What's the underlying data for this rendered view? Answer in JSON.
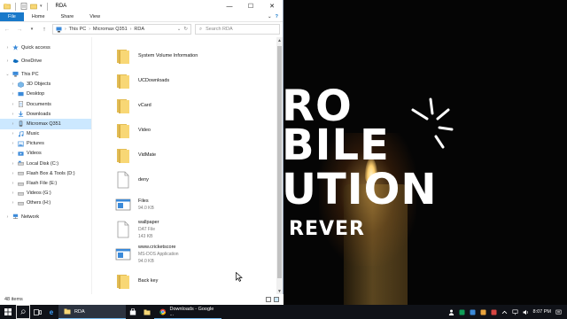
{
  "window": {
    "title": "RDA",
    "minimize": "—",
    "maximize": "☐",
    "close": "✕"
  },
  "ribbon": {
    "tabs": [
      "File",
      "Home",
      "Share",
      "View"
    ],
    "expand": "⌄",
    "help": "?"
  },
  "address": {
    "crumbs": [
      "This PC",
      "Micromax Q351",
      "RDA"
    ],
    "search_placeholder": "Search RDA"
  },
  "nav": {
    "items": [
      {
        "label": "Quick access",
        "icon": "star-icon"
      },
      {
        "label": "OneDrive",
        "icon": "cloud-icon"
      },
      {
        "label": "This PC",
        "icon": "pc-icon"
      },
      {
        "label": "3D Objects",
        "icon": "cube-icon"
      },
      {
        "label": "Desktop",
        "icon": "desktop-icon"
      },
      {
        "label": "Documents",
        "icon": "documents-icon"
      },
      {
        "label": "Downloads",
        "icon": "downloads-icon"
      },
      {
        "label": "Micromax Q351",
        "icon": "phone-icon"
      },
      {
        "label": "Music",
        "icon": "music-icon"
      },
      {
        "label": "Pictures",
        "icon": "pictures-icon"
      },
      {
        "label": "Videos",
        "icon": "videos-icon"
      },
      {
        "label": "Local Disk (C:)",
        "icon": "drive-icon"
      },
      {
        "label": "Flash Box & Tools (D:)",
        "icon": "drive-icon"
      },
      {
        "label": "Flash File (E:)",
        "icon": "drive-icon"
      },
      {
        "label": "Videos (G:)",
        "icon": "drive-icon"
      },
      {
        "label": "Others (H:)",
        "icon": "drive-icon"
      },
      {
        "label": "Network",
        "icon": "network-icon"
      }
    ]
  },
  "files": [
    {
      "name": "System Volume Information",
      "type": "folder"
    },
    {
      "name": "UCDownloads",
      "type": "folder"
    },
    {
      "name": "vCard",
      "type": "folder"
    },
    {
      "name": "Video",
      "type": "folder"
    },
    {
      "name": "VidMate",
      "type": "folder"
    },
    {
      "name": "deny",
      "type": "file"
    },
    {
      "name": "Files",
      "type": "app",
      "sub1": "94.0 KB"
    },
    {
      "name": "wallpaper",
      "type": "file",
      "sub1": "DAT File",
      "sub2": "143 KB"
    },
    {
      "name": "www.cricketscore",
      "type": "app",
      "sub1": "MS-DOS Application",
      "sub2": "94.0 KB"
    },
    {
      "name": "Back key",
      "type": "folder"
    }
  ],
  "status": {
    "count": "48 items"
  },
  "desktop": {
    "line1": "RO",
    "line2": "BILE",
    "line3": "UTION",
    "line4": "REVER"
  },
  "taskbar": {
    "explorer_task": "RDA",
    "chrome_task": "Downloads - Google ...",
    "time": "8:07 PM",
    "accent": "#76b9ed"
  },
  "colors": {
    "file_tab": "#1979ca",
    "selection": "#cce8ff",
    "folder": "#f8d775"
  }
}
